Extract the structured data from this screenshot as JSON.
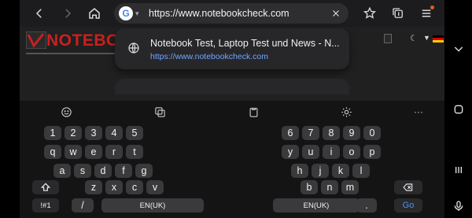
{
  "browser": {
    "url": "https://www.notebookcheck.com",
    "search_engine_logo": "G"
  },
  "site": {
    "logo_text": "NOTEBOC"
  },
  "suggestion": {
    "title": "Notebook Test, Laptop Test und News - N...",
    "url": "https://www.notebookcheck.com"
  },
  "keyboard": {
    "left_rows": [
      [
        "1",
        "2",
        "3",
        "4",
        "5"
      ],
      [
        "q",
        "w",
        "e",
        "r",
        "t"
      ],
      [
        "a",
        "s",
        "d",
        "f",
        "g"
      ],
      [
        "z",
        "x",
        "c",
        "v"
      ]
    ],
    "right_rows": [
      [
        "6",
        "7",
        "8",
        "9",
        "0"
      ],
      [
        "y",
        "u",
        "i",
        "o",
        "p"
      ],
      [
        "h",
        "j",
        "k",
        "l"
      ],
      [
        "b",
        "n",
        "m"
      ]
    ],
    "symbols_key": "!#1",
    "slash_key": "/",
    "space_left": "EN(UK)",
    "space_right": "EN(UK)",
    "dot_key": ".",
    "go_key": "Go",
    "toolbar_more": "···"
  },
  "colors": {
    "accent": "#4f8ff7",
    "link": "#6ea8ff",
    "brand": "#cc1f1f"
  }
}
